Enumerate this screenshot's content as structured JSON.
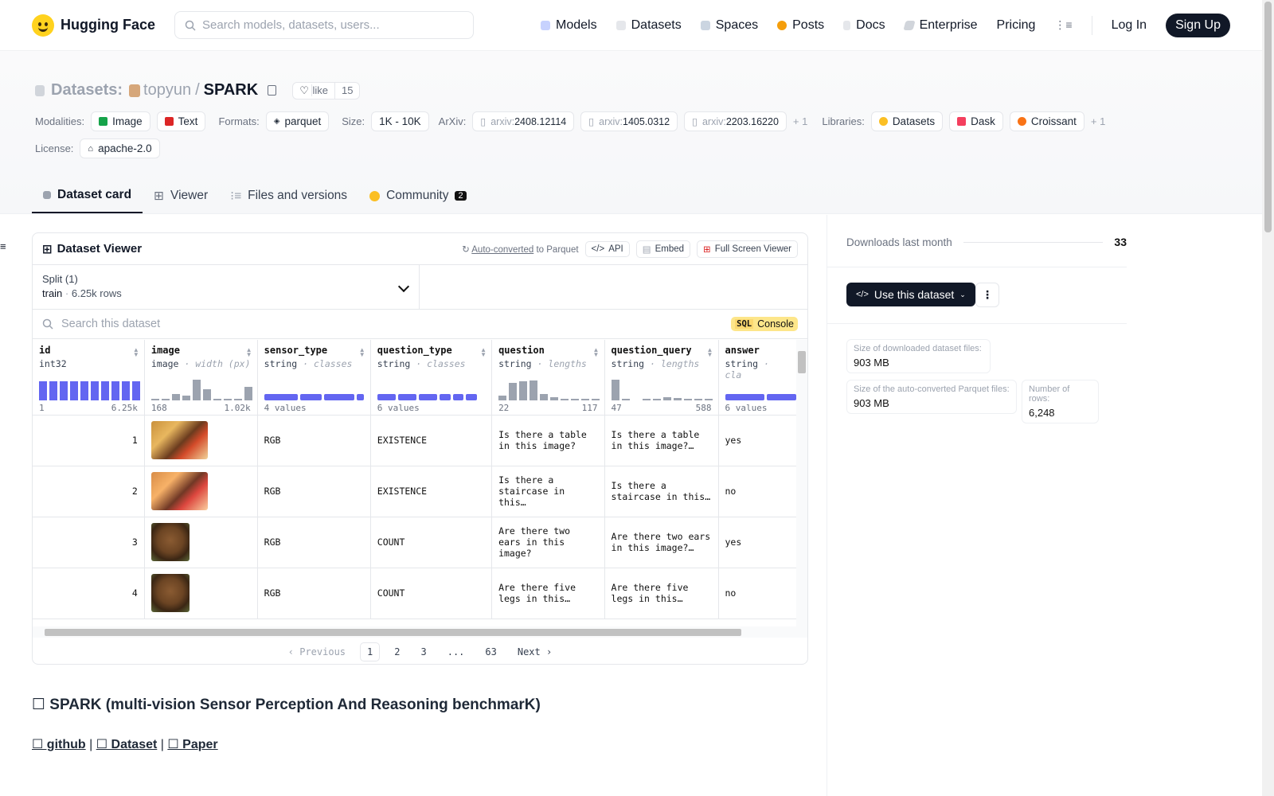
{
  "brand": {
    "name": "Hugging Face"
  },
  "search": {
    "placeholder": "Search models, datasets, users..."
  },
  "nav": {
    "models": "Models",
    "datasets": "Datasets",
    "spaces": "Spaces",
    "posts": "Posts",
    "docs": "Docs",
    "enterprise": "Enterprise",
    "pricing": "Pricing",
    "login": "Log In",
    "signup": "Sign Up"
  },
  "repo": {
    "prefix": "Datasets:",
    "owner": "topyun",
    "sep": "/",
    "name": "SPARK",
    "like_label": "like",
    "like_count": "15"
  },
  "meta": {
    "modalities_label": "Modalities:",
    "modalities": [
      "Image",
      "Text"
    ],
    "formats_label": "Formats:",
    "format": "parquet",
    "size_label": "Size:",
    "size": "1K - 10K",
    "arxiv_label": "ArXiv:",
    "arxiv_prefix": "arxiv:",
    "arxiv": [
      "2408.12114",
      "1405.0312",
      "2203.16220"
    ],
    "arxiv_more": "+ 1",
    "libraries_label": "Libraries:",
    "libraries": [
      "Datasets",
      "Dask",
      "Croissant"
    ],
    "libraries_more": "+ 1",
    "license_label": "License:",
    "license": "apache-2.0"
  },
  "tabs": {
    "card": "Dataset card",
    "viewer": "Viewer",
    "files": "Files and versions",
    "community": "Community",
    "community_count": "2"
  },
  "viewer": {
    "title": "Dataset Viewer",
    "auto_converted": "Auto-converted",
    "to_parquet": "to Parquet",
    "api": "API",
    "embed": "Embed",
    "fullscreen": "Full Screen Viewer",
    "split_label": "Split (1)",
    "split_name": "train",
    "split_rows": "6.25k rows",
    "search_placeholder": "Search this dataset",
    "sql_tag": "SQL",
    "sql_label": "Console",
    "columns": [
      {
        "name": "id",
        "type": "int32",
        "stat": "",
        "min": "1",
        "max": "6.25k"
      },
      {
        "name": "image",
        "type": "image",
        "stat": "· width (px)",
        "min": "168",
        "max": "1.02k"
      },
      {
        "name": "sensor_type",
        "type": "string",
        "stat": "· classes",
        "min": "4 values",
        "max": ""
      },
      {
        "name": "question_type",
        "type": "string",
        "stat": "· classes",
        "min": "6 values",
        "max": ""
      },
      {
        "name": "question",
        "type": "string",
        "stat": "· lengths",
        "min": "22",
        "max": "117"
      },
      {
        "name": "question_query",
        "type": "string",
        "stat": "· lengths",
        "min": "47",
        "max": "588"
      },
      {
        "name": "answer",
        "type": "string",
        "stat": "· cla",
        "min": "6 values",
        "max": ""
      }
    ],
    "rows": [
      {
        "id": "1",
        "sensor_type": "RGB",
        "question_type": "EXISTENCE",
        "question": "Is there a table in this image?",
        "question_query": "Is there a table in this image?…",
        "answer": "yes"
      },
      {
        "id": "2",
        "sensor_type": "RGB",
        "question_type": "EXISTENCE",
        "question": "Is there a staircase in this…",
        "question_query": "Is there a staircase in this…",
        "answer": "no"
      },
      {
        "id": "3",
        "sensor_type": "RGB",
        "question_type": "COUNT",
        "question": "Are there two ears in this image?",
        "question_query": "Are there two ears in this image?…",
        "answer": "yes"
      },
      {
        "id": "4",
        "sensor_type": "RGB",
        "question_type": "COUNT",
        "question": "Are there five legs in this…",
        "question_query": "Are there five legs in this…",
        "answer": "no"
      }
    ],
    "pager": {
      "prev": "Previous",
      "p1": "1",
      "p2": "2",
      "p3": "3",
      "ellipsis": "...",
      "last": "63",
      "next": "Next"
    }
  },
  "card": {
    "heading": "☐ SPARK (multi-vision Sensor Perception And Reasoning benchmarK)",
    "github": "☐ github",
    "dataset": "☐ Dataset",
    "paper": "☐ Paper",
    "pipe": "|"
  },
  "sidebar": {
    "downloads_label": "Downloads last month",
    "downloads": "33",
    "use_label": "Use this dataset",
    "size_dl_label": "Size of downloaded dataset files:",
    "size_dl": "903 MB",
    "size_pq_label": "Size of the auto-converted Parquet files:",
    "size_pq": "903 MB",
    "rows_label": "Number of rows:",
    "rows": "6,248"
  }
}
